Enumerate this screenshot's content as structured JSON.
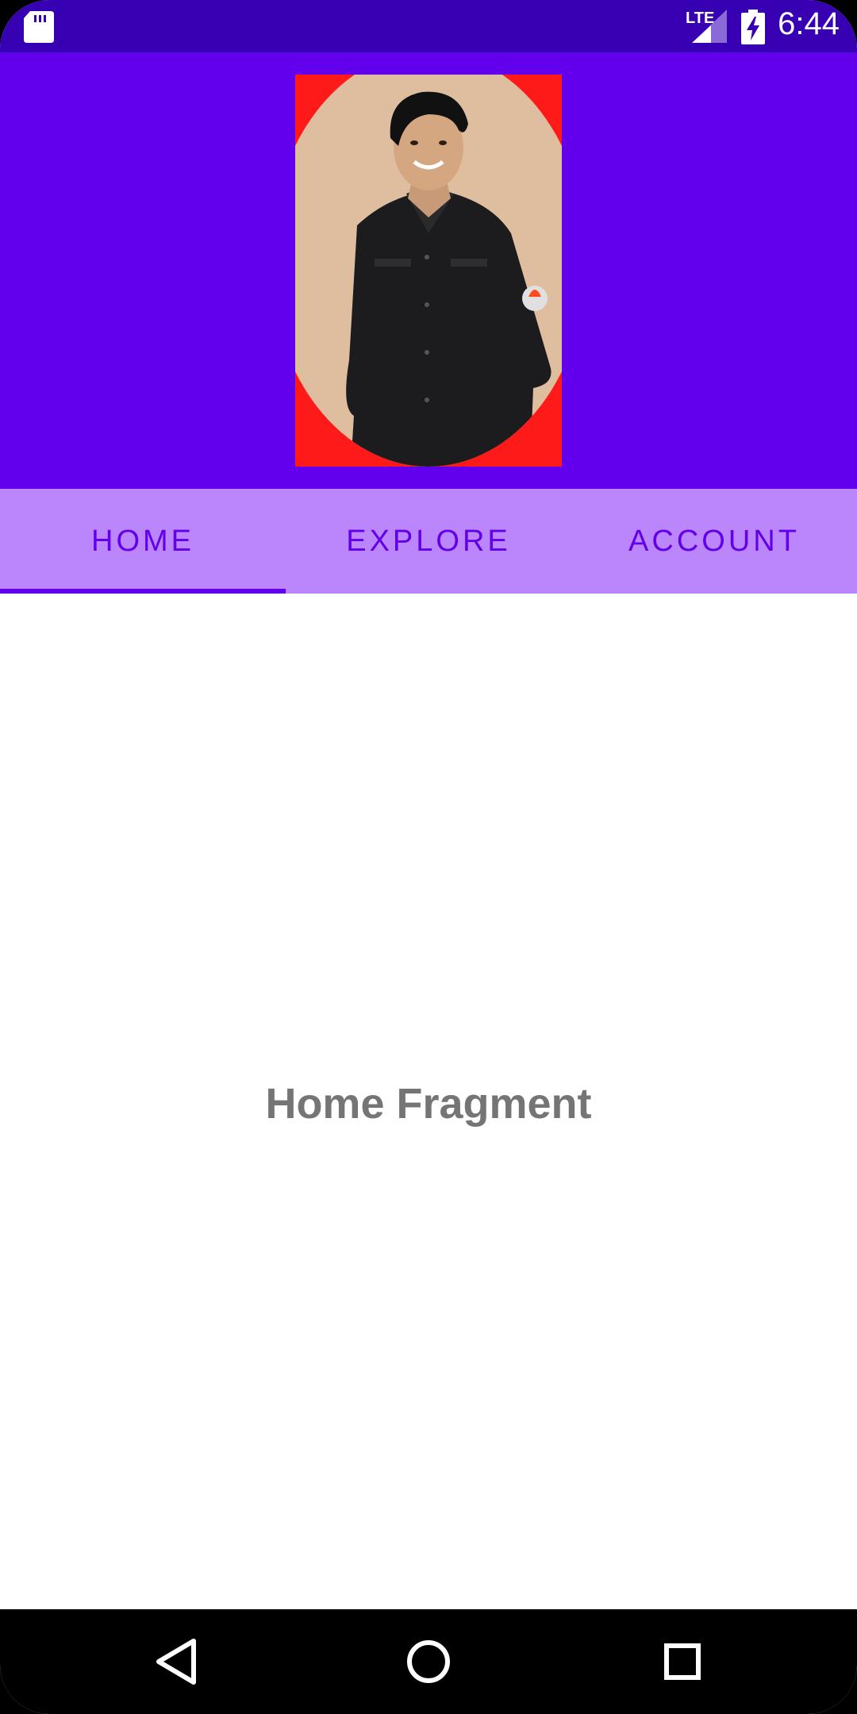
{
  "status_bar": {
    "network_label": "LTE",
    "time": "6:44",
    "background": "#3700b3",
    "icons": [
      "sd-card-icon",
      "signal-icon",
      "battery-charging-icon"
    ]
  },
  "header": {
    "background": "#6200ee",
    "photo_alt": "profile photo"
  },
  "tabs": [
    {
      "label": "HOME",
      "selected": true
    },
    {
      "label": "EXPLORE",
      "selected": false
    },
    {
      "label": "ACCOUNT",
      "selected": false
    }
  ],
  "tab_bar": {
    "background": "#bb86fc",
    "text_color": "#6200ee"
  },
  "content": {
    "fragment_text": "Home Fragment"
  },
  "nav_bar": {
    "buttons": [
      "back-icon",
      "home-icon",
      "recents-icon"
    ]
  }
}
